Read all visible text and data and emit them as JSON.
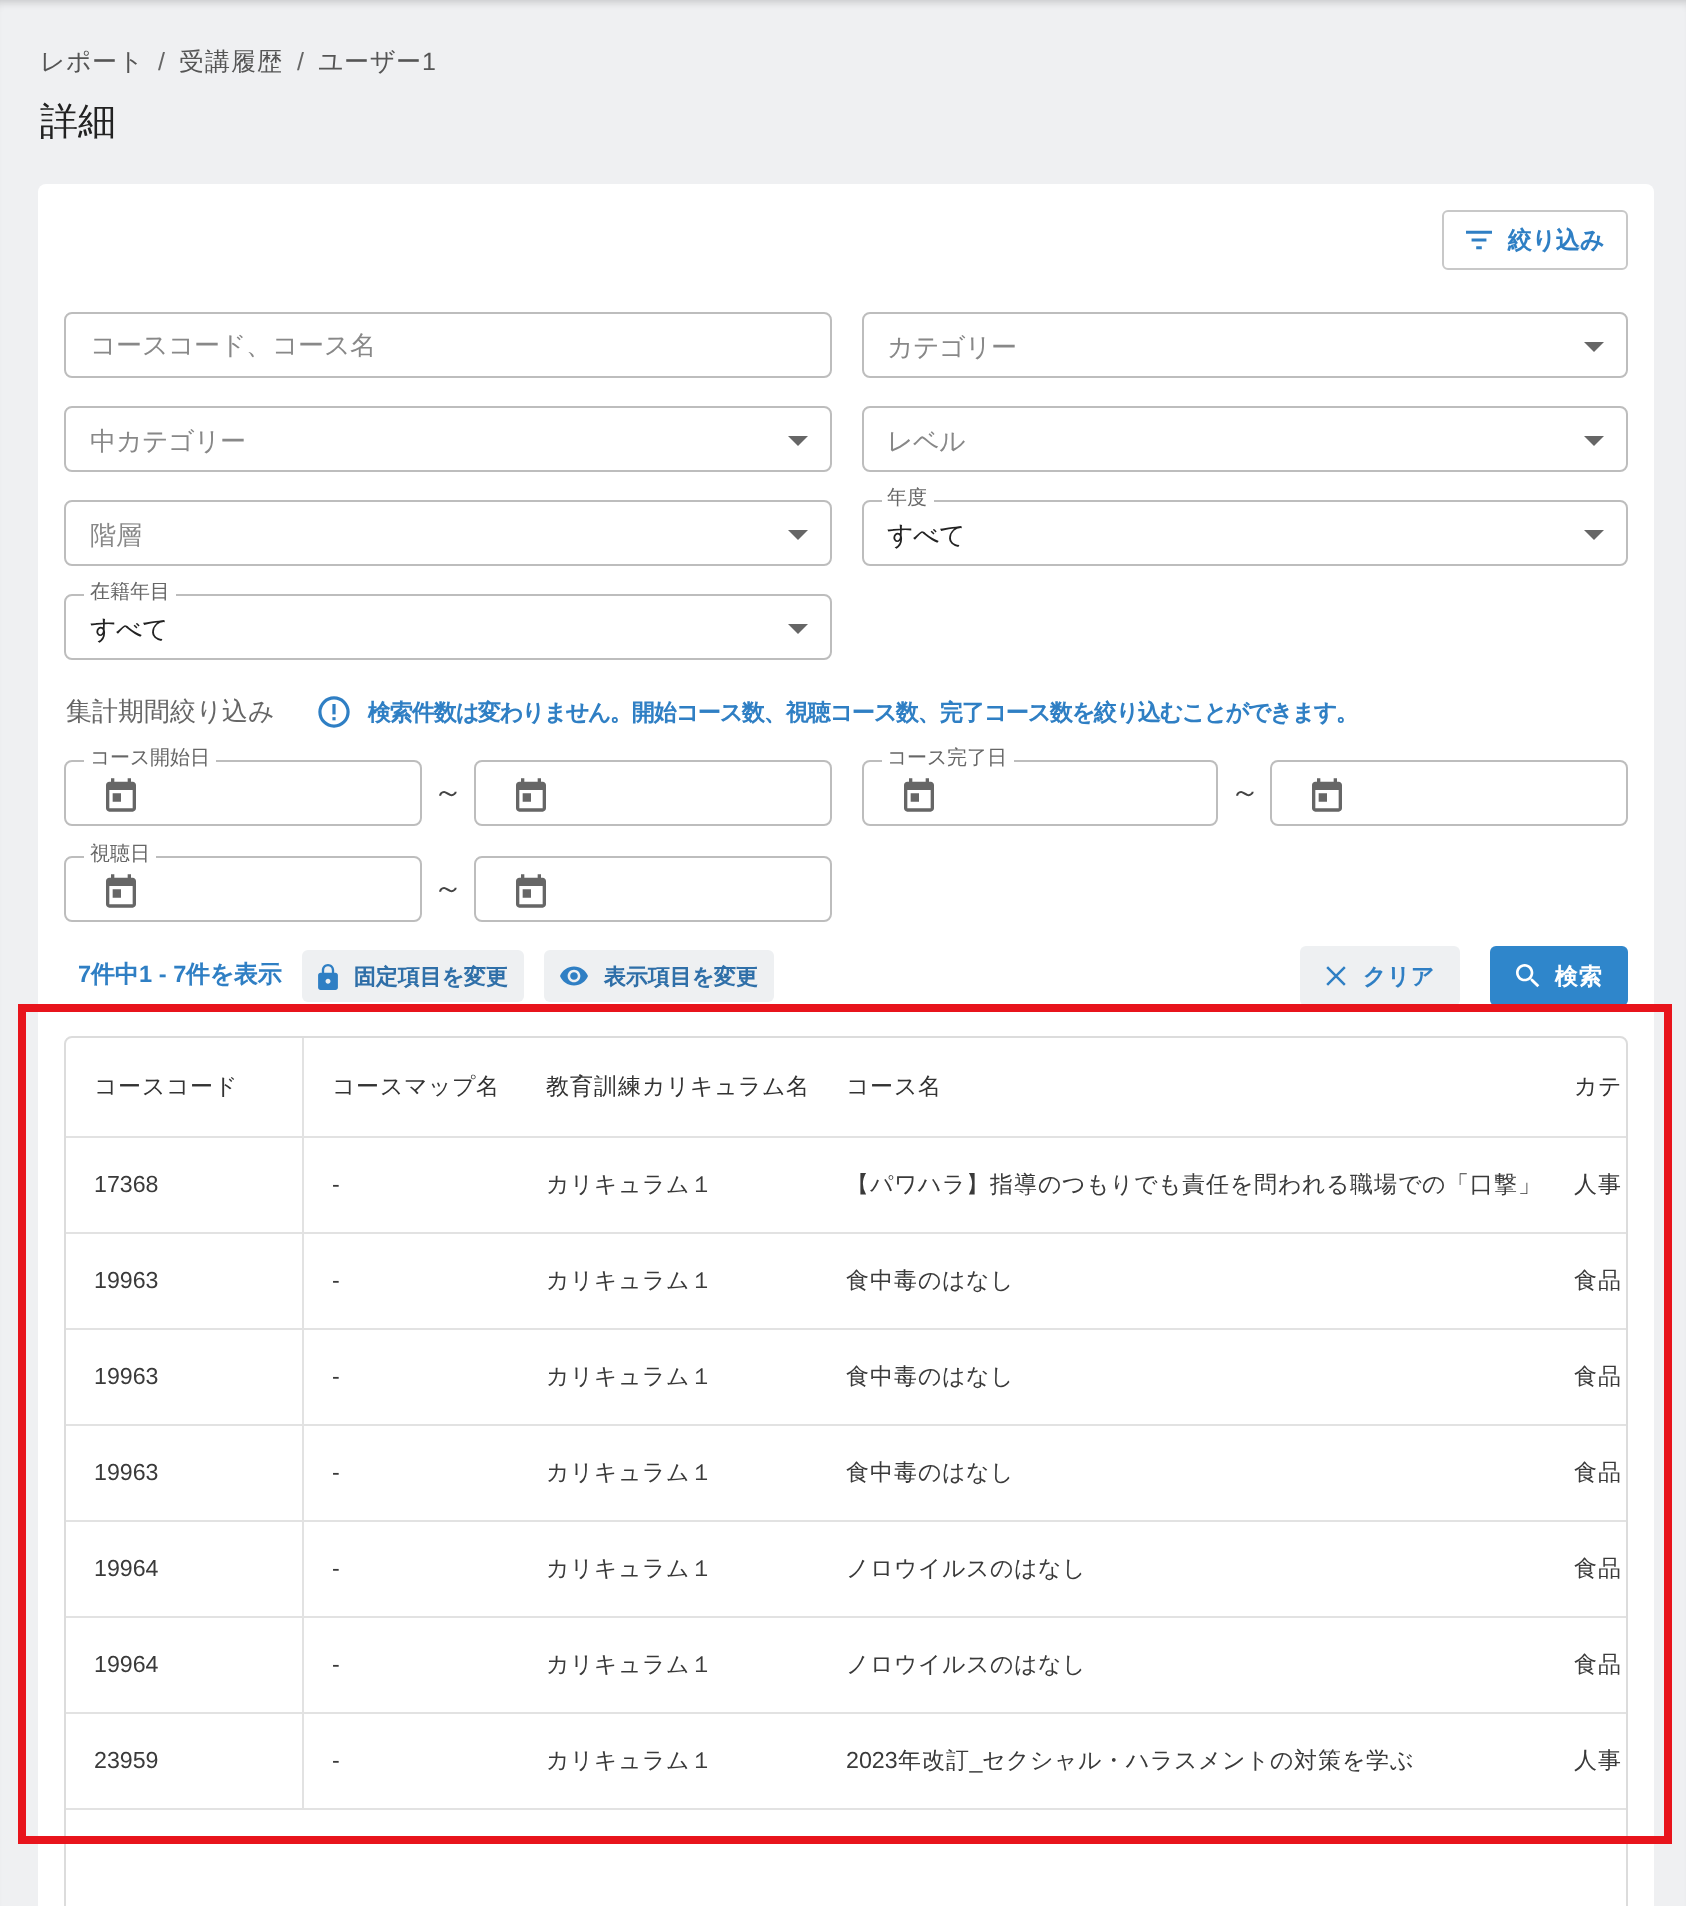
{
  "breadcrumb": {
    "items": [
      "レポート",
      "受講履歴",
      "ユーザー1"
    ],
    "separators": [
      "/",
      "/"
    ]
  },
  "title": "詳細",
  "filter_button": {
    "label": "絞り込み"
  },
  "field_rows": [
    [
      {
        "kind": "text",
        "placeholder": "コースコード、コース名"
      },
      {
        "kind": "select",
        "placeholder": "カテゴリー"
      }
    ],
    [
      {
        "kind": "select",
        "placeholder": "中カテゴリー"
      },
      {
        "kind": "select",
        "placeholder": "レベル"
      }
    ],
    [
      {
        "kind": "select",
        "placeholder": "階層"
      },
      {
        "kind": "select",
        "label": "年度",
        "value": "すべて"
      }
    ],
    [
      {
        "kind": "select",
        "label": "在籍年目",
        "value": "すべて"
      }
    ]
  ],
  "period_filter": {
    "label": "集計期間絞り込み",
    "note": "検索件数は変わりません。開始コース数、視聴コース数、完了コース数を絞り込むことができます。"
  },
  "date_ranges": [
    {
      "label": "コース開始日",
      "separator": "～"
    },
    {
      "label": "コース完了日",
      "separator": "～"
    },
    {
      "label": "視聴日",
      "separator": "～"
    }
  ],
  "result_count": "7件中1 - 7件を表示",
  "fixed_columns_button": {
    "label": "固定項目を変更"
  },
  "visible_columns_button": {
    "label": "表示項目を変更"
  },
  "clear_button": {
    "label": "クリア"
  },
  "search_button": {
    "label": "検索"
  },
  "table": {
    "columns": [
      "コースコード",
      "コースマップ名",
      "教育訓練カリキュラム名",
      "コース名",
      "カテ"
    ],
    "rows": [
      [
        "17368",
        "-",
        "カリキュラム１",
        "【パワハラ】指導のつもりでも責任を問われる職場での「口撃」",
        "人事"
      ],
      [
        "19963",
        "-",
        "カリキュラム１",
        "食中毒のはなし",
        "食品"
      ],
      [
        "19963",
        "-",
        "カリキュラム１",
        "食中毒のはなし",
        "食品"
      ],
      [
        "19963",
        "-",
        "カリキュラム１",
        "食中毒のはなし",
        "食品"
      ],
      [
        "19964",
        "-",
        "カリキュラム１",
        "ノロウイルスのはなし",
        "食品"
      ],
      [
        "19964",
        "-",
        "カリキュラム１",
        "ノロウイルスのはなし",
        "食品"
      ],
      [
        "23959",
        "-",
        "カリキュラム１",
        "2023年改訂_セクシャル・ハラスメントの対策を学ぶ",
        "人事"
      ]
    ]
  }
}
